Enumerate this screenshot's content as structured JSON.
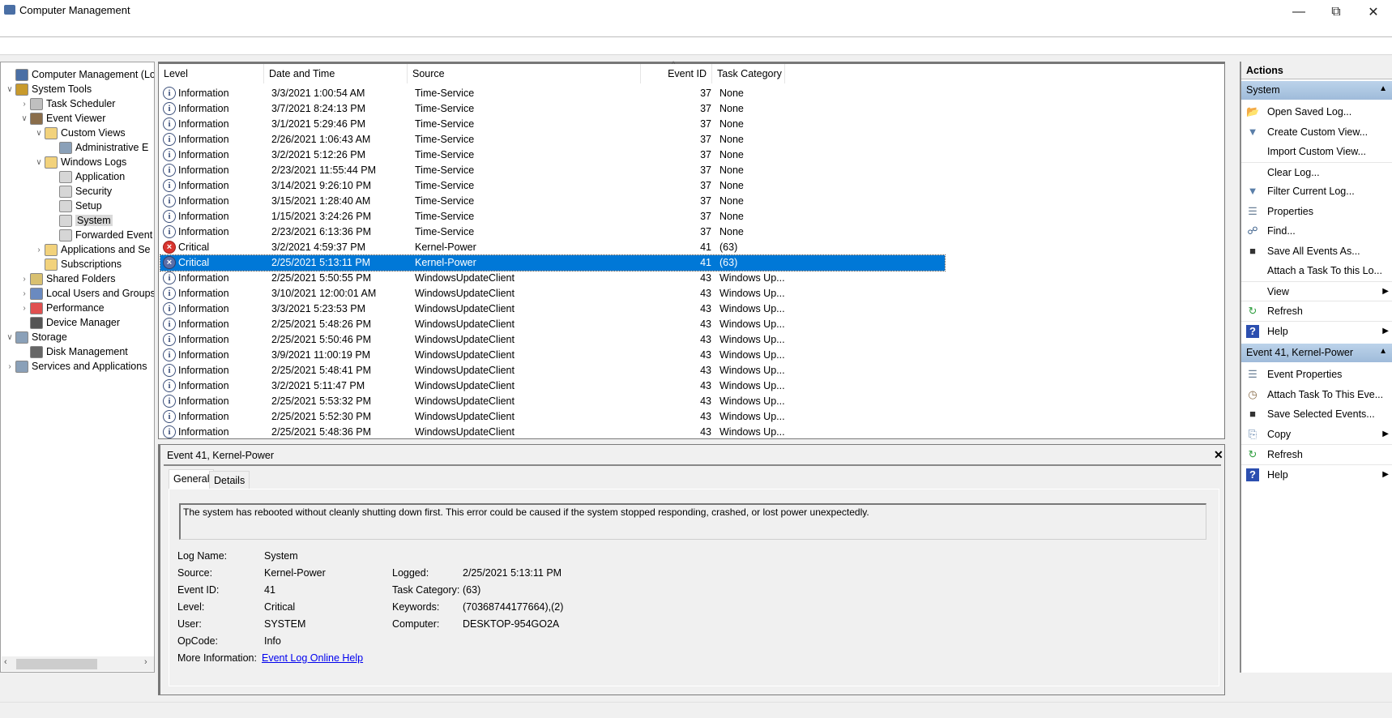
{
  "window": {
    "title": "Computer Management"
  },
  "tree": [
    {
      "label": "Computer Management (Local",
      "level": 0,
      "chev": "",
      "color": "#4a6fa5"
    },
    {
      "label": "System Tools",
      "level": 0,
      "chev": "v",
      "color": "#c89a2c"
    },
    {
      "label": "Task Scheduler",
      "level": 1,
      "chev": ">",
      "color": "#bfbfbf"
    },
    {
      "label": "Event Viewer",
      "level": 1,
      "chev": "v",
      "color": "#8a6d4a"
    },
    {
      "label": "Custom Views",
      "level": 2,
      "chev": "v",
      "color": "#f2d27c"
    },
    {
      "label": "Administrative E",
      "level": 3,
      "chev": "",
      "color": "#8aa0b8"
    },
    {
      "label": "Windows Logs",
      "level": 2,
      "chev": "v",
      "color": "#f2d27c"
    },
    {
      "label": "Application",
      "level": 3,
      "chev": "",
      "color": "#d6d6d6"
    },
    {
      "label": "Security",
      "level": 3,
      "chev": "",
      "color": "#d6d6d6"
    },
    {
      "label": "Setup",
      "level": 3,
      "chev": "",
      "color": "#d6d6d6"
    },
    {
      "label": "System",
      "level": 3,
      "chev": "",
      "color": "#d6d6d6",
      "selected": true
    },
    {
      "label": "Forwarded Event",
      "level": 3,
      "chev": "",
      "color": "#d6d6d6"
    },
    {
      "label": "Applications and Se",
      "level": 2,
      "chev": ">",
      "color": "#f2d27c"
    },
    {
      "label": "Subscriptions",
      "level": 2,
      "chev": "",
      "color": "#f2d27c"
    },
    {
      "label": "Shared Folders",
      "level": 1,
      "chev": ">",
      "color": "#d8c070"
    },
    {
      "label": "Local Users and Groups",
      "level": 1,
      "chev": ">",
      "color": "#6a8ac0"
    },
    {
      "label": "Performance",
      "level": 1,
      "chev": ">",
      "color": "#e05050"
    },
    {
      "label": "Device Manager",
      "level": 1,
      "chev": "",
      "color": "#555555"
    },
    {
      "label": "Storage",
      "level": 0,
      "chev": "v",
      "color": "#8aa0b8"
    },
    {
      "label": "Disk Management",
      "level": 1,
      "chev": "",
      "color": "#666666"
    },
    {
      "label": "Services and Applications",
      "level": 0,
      "chev": ">",
      "color": "#8aa0b8"
    }
  ],
  "table": {
    "columns": [
      "Level",
      "Date and Time",
      "Source",
      "Event ID",
      "Task Category"
    ],
    "rows": [
      [
        "Information",
        "3/3/2021 1:00:54 AM",
        "Time-Service",
        "37",
        "None"
      ],
      [
        "Information",
        "3/7/2021 8:24:13 PM",
        "Time-Service",
        "37",
        "None"
      ],
      [
        "Information",
        "3/1/2021 5:29:46 PM",
        "Time-Service",
        "37",
        "None"
      ],
      [
        "Information",
        "2/26/2021 1:06:43 AM",
        "Time-Service",
        "37",
        "None"
      ],
      [
        "Information",
        "3/2/2021 5:12:26 PM",
        "Time-Service",
        "37",
        "None"
      ],
      [
        "Information",
        "2/23/2021 11:55:44 PM",
        "Time-Service",
        "37",
        "None"
      ],
      [
        "Information",
        "3/14/2021 9:26:10 PM",
        "Time-Service",
        "37",
        "None"
      ],
      [
        "Information",
        "3/15/2021 1:28:40 AM",
        "Time-Service",
        "37",
        "None"
      ],
      [
        "Information",
        "1/15/2021 3:24:26 PM",
        "Time-Service",
        "37",
        "None"
      ],
      [
        "Information",
        "2/23/2021 6:13:36 PM",
        "Time-Service",
        "37",
        "None"
      ],
      [
        "Critical",
        "3/2/2021 4:59:37 PM",
        "Kernel-Power",
        "41",
        "(63)"
      ],
      [
        "Critical",
        "2/25/2021 5:13:11 PM",
        "Kernel-Power",
        "41",
        "(63)"
      ],
      [
        "Information",
        "2/25/2021 5:50:55 PM",
        "WindowsUpdateClient",
        "43",
        "Windows Up..."
      ],
      [
        "Information",
        "3/10/2021 12:00:01 AM",
        "WindowsUpdateClient",
        "43",
        "Windows Up..."
      ],
      [
        "Information",
        "3/3/2021 5:23:53 PM",
        "WindowsUpdateClient",
        "43",
        "Windows Up..."
      ],
      [
        "Information",
        "2/25/2021 5:48:26 PM",
        "WindowsUpdateClient",
        "43",
        "Windows Up..."
      ],
      [
        "Information",
        "2/25/2021 5:50:46 PM",
        "WindowsUpdateClient",
        "43",
        "Windows Up..."
      ],
      [
        "Information",
        "3/9/2021 11:00:19 PM",
        "WindowsUpdateClient",
        "43",
        "Windows Up..."
      ],
      [
        "Information",
        "2/25/2021 5:48:41 PM",
        "WindowsUpdateClient",
        "43",
        "Windows Up..."
      ],
      [
        "Information",
        "3/2/2021 5:11:47 PM",
        "WindowsUpdateClient",
        "43",
        "Windows Up..."
      ],
      [
        "Information",
        "2/25/2021 5:53:32 PM",
        "WindowsUpdateClient",
        "43",
        "Windows Up..."
      ],
      [
        "Information",
        "2/25/2021 5:52:30 PM",
        "WindowsUpdateClient",
        "43",
        "Windows Up..."
      ],
      [
        "Information",
        "2/25/2021 5:48:36 PM",
        "WindowsUpdateClient",
        "43",
        "Windows Up..."
      ]
    ],
    "selected_index": 11
  },
  "detail": {
    "title": "Event 41, Kernel-Power",
    "tabs": [
      "General",
      "Details"
    ],
    "message": "The system has rebooted without cleanly shutting down first. This error could be caused if the system stopped responding, crashed, or lost power unexpectedly.",
    "log_name_label": "Log Name:",
    "log_name": "System",
    "source_label": "Source:",
    "source": "Kernel-Power",
    "event_id_label": "Event ID:",
    "event_id": "41",
    "level_label": "Level:",
    "level": "Critical",
    "user_label": "User:",
    "user": "SYSTEM",
    "opcode_label": "OpCode:",
    "opcode": "Info",
    "more_info_label": "More Information:",
    "more_info_link": "Event Log Online Help",
    "logged_label": "Logged:",
    "logged": "2/25/2021 5:13:11 PM",
    "task_category_label": "Task Category:",
    "task_category": "(63)",
    "keywords_label": "Keywords:",
    "keywords": "(70368744177664),(2)",
    "computer_label": "Computer:",
    "computer": "DESKTOP-954GO2A"
  },
  "actions": {
    "header": "Actions",
    "sections": [
      {
        "title": "System",
        "items": [
          {
            "label": "Open Saved Log...",
            "icon": "folder-open-icon"
          },
          {
            "label": "Create Custom View...",
            "icon": "filter-icon"
          },
          {
            "label": "Import Custom View...",
            "icon": ""
          },
          {
            "label": "Clear Log...",
            "icon": "",
            "sep": true
          },
          {
            "label": "Filter Current Log...",
            "icon": "filter-icon"
          },
          {
            "label": "Properties",
            "icon": "properties-icon"
          },
          {
            "label": "Find...",
            "icon": "binoculars-icon"
          },
          {
            "label": "Save All Events As...",
            "icon": "save-icon"
          },
          {
            "label": "Attach a Task To this Lo...",
            "icon": ""
          },
          {
            "label": "View",
            "icon": "",
            "sep": true,
            "submenu": true
          },
          {
            "label": "Refresh",
            "icon": "refresh-icon",
            "sep": true
          },
          {
            "label": "Help",
            "icon": "help-icon",
            "sep": true,
            "submenu": true
          }
        ]
      },
      {
        "title": "Event 41, Kernel-Power",
        "items": [
          {
            "label": "Event Properties",
            "icon": "properties-icon"
          },
          {
            "label": "Attach Task To This Eve...",
            "icon": "task-clock-icon"
          },
          {
            "label": "Save Selected Events...",
            "icon": "save-icon"
          },
          {
            "label": "Copy",
            "icon": "copy-icon",
            "submenu": true
          },
          {
            "label": "Refresh",
            "icon": "refresh-icon",
            "sep": true
          },
          {
            "label": "Help",
            "icon": "help-icon",
            "sep": true,
            "submenu": true
          }
        ]
      }
    ]
  },
  "colors": {
    "selection": "#0078d7",
    "band": "#b4cce6",
    "link": "#0000ee",
    "critical": "#d9352f"
  }
}
